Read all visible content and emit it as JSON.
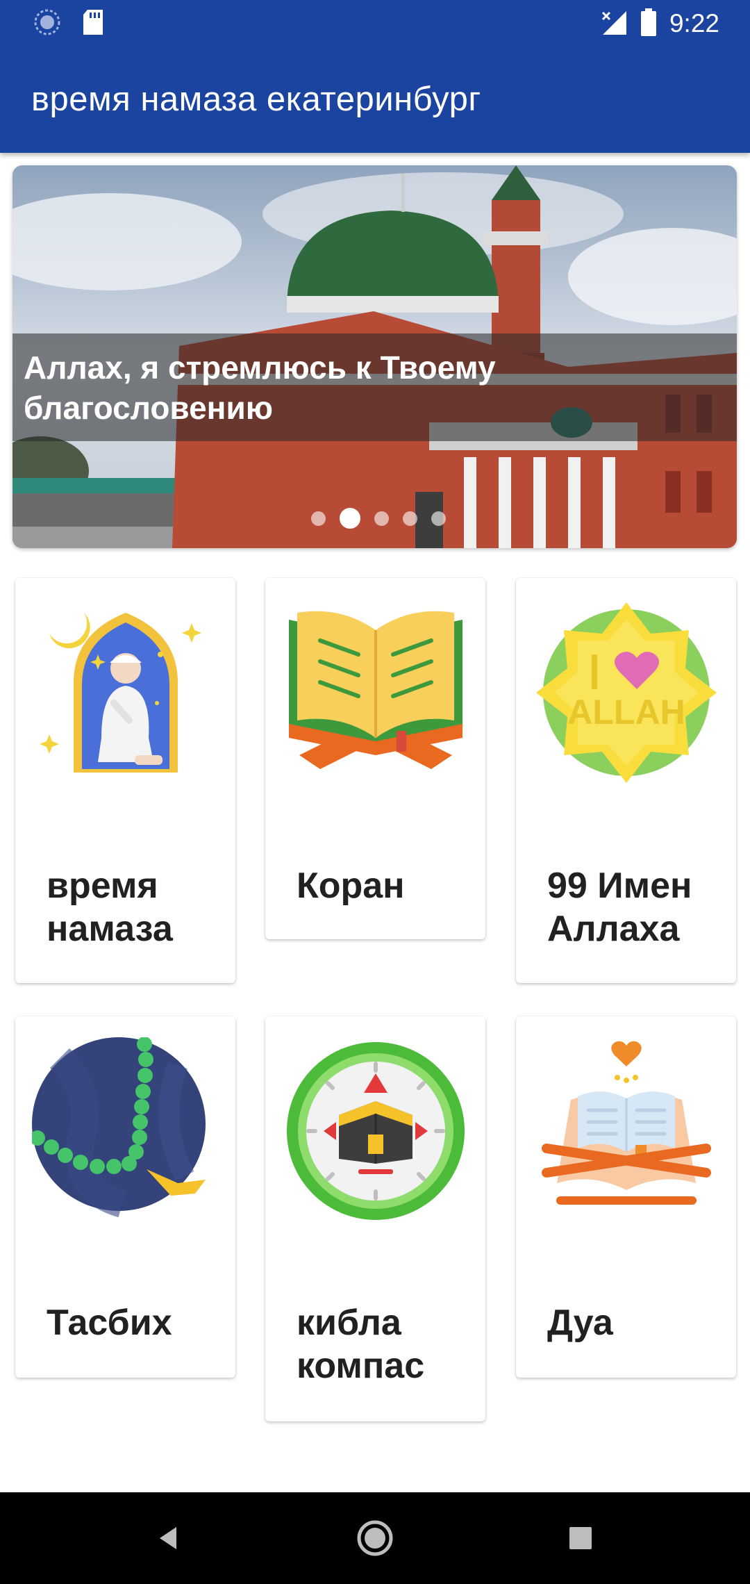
{
  "status_bar": {
    "time": "9:22",
    "icons": [
      "sync-icon",
      "sd-card-icon",
      "signal-icon",
      "battery-icon"
    ]
  },
  "app_bar": {
    "title": "время намаза екатеринбург",
    "background_color": "#1a44a0"
  },
  "banner": {
    "caption": "Аллах, я стремлюсь к Твоему благословению",
    "slide_count": 5,
    "active_slide": 2
  },
  "grid": {
    "items": [
      {
        "label": "время намаза",
        "icon": "prayer-icon"
      },
      {
        "label": "Коран",
        "icon": "quran-icon"
      },
      {
        "label": "99 Имен Аллаха",
        "icon": "allah-names-icon"
      },
      {
        "label": "Тасбих",
        "icon": "tasbih-icon"
      },
      {
        "label": "кибла компас",
        "icon": "qibla-compass-icon"
      },
      {
        "label": "Дуа",
        "icon": "dua-icon"
      }
    ]
  },
  "nav_bar": {
    "buttons": [
      "back-icon",
      "home-icon",
      "recents-icon"
    ]
  }
}
